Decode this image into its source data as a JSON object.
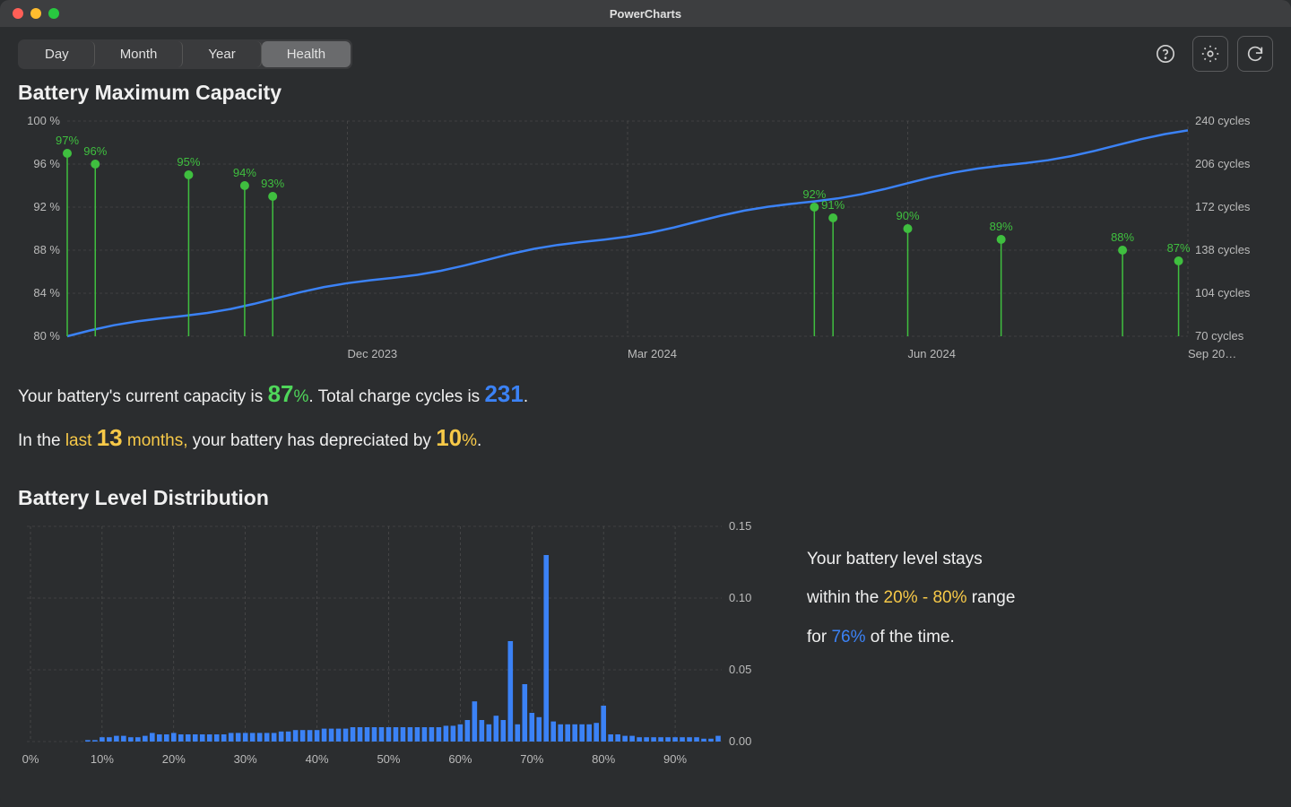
{
  "app_title": "PowerCharts",
  "tabs": {
    "day": "Day",
    "month": "Month",
    "year": "Year",
    "health": "Health",
    "active": "Health"
  },
  "sections": {
    "capacity_title": "Battery Maximum Capacity",
    "distribution_title": "Battery Level Distribution"
  },
  "summary1": {
    "pre_capacity": "Your battery's current capacity is ",
    "capacity_val": "87",
    "capacity_pct": "%",
    "mid": ". Total charge cycles is ",
    "cycles_val": "231",
    "end1": ".",
    "line2_a": "In the ",
    "line2_b": "last ",
    "months_val": "13",
    "months_unit": " months,",
    "line2_c": " your battery has depreciated by ",
    "dep_val": "10",
    "dep_pct": "%",
    "end2": "."
  },
  "summary2": {
    "l1": "Your battery level stays",
    "l2a": "within the ",
    "range_lo": "20",
    "range_sep": "% - ",
    "range_hi": "80",
    "range_pct": "%",
    "l2b": " range",
    "l3a": "for ",
    "pct_val": "76",
    "pct_unit": "%",
    "l3b": " of the time."
  },
  "chart_data": [
    {
      "type": "line+lollipop",
      "title": "Battery Maximum Capacity",
      "x_domain_months": [
        "Sep 2023",
        "Oct 2023",
        "Nov 2023",
        "Dec 2023",
        "Jan 2024",
        "Feb 2024",
        "Mar 2024",
        "Apr 2024",
        "May 2024",
        "Jun 2024",
        "Jul 2024",
        "Aug 2024",
        "Sep 2024"
      ],
      "y_left_label": "%",
      "y_left_ticks": [
        80,
        84,
        88,
        92,
        96,
        100
      ],
      "y_right_label": "cycles",
      "y_right_ticks": [
        70,
        104,
        138,
        172,
        206,
        240
      ],
      "x_ticks": [
        "Dec 2023",
        "Mar 2024",
        "Jun 2024",
        "Sep 20…"
      ],
      "capacity_points": [
        {
          "month_index": 0.0,
          "pct": 97
        },
        {
          "month_index": 0.3,
          "pct": 96
        },
        {
          "month_index": 1.3,
          "pct": 95
        },
        {
          "month_index": 1.9,
          "pct": 94
        },
        {
          "month_index": 2.2,
          "pct": 93
        },
        {
          "month_index": 8.0,
          "pct": 92
        },
        {
          "month_index": 8.2,
          "pct": 91
        },
        {
          "month_index": 9.0,
          "pct": 90
        },
        {
          "month_index": 10.0,
          "pct": 89
        },
        {
          "month_index": 11.3,
          "pct": 88
        },
        {
          "month_index": 11.9,
          "pct": 87
        }
      ],
      "cycles_line": {
        "start": {
          "month_index": 0.0,
          "cycles": 70
        },
        "end": {
          "month_index": 12.0,
          "cycles": 231
        }
      }
    },
    {
      "type": "bar",
      "title": "Battery Level Distribution",
      "x_label": "%",
      "x_ticks": [
        0,
        10,
        20,
        30,
        40,
        50,
        60,
        70,
        80,
        90
      ],
      "y_label": "",
      "y_ticks": [
        0.0,
        0.05,
        0.1,
        0.15
      ],
      "ylim": [
        0,
        0.15
      ],
      "categories": [
        0,
        1,
        2,
        3,
        4,
        5,
        6,
        7,
        8,
        9,
        10,
        11,
        12,
        13,
        14,
        15,
        16,
        17,
        18,
        19,
        20,
        21,
        22,
        23,
        24,
        25,
        26,
        27,
        28,
        29,
        30,
        31,
        32,
        33,
        34,
        35,
        36,
        37,
        38,
        39,
        40,
        41,
        42,
        43,
        44,
        45,
        46,
        47,
        48,
        49,
        50,
        51,
        52,
        53,
        54,
        55,
        56,
        57,
        58,
        59,
        60,
        61,
        62,
        63,
        64,
        65,
        66,
        67,
        68,
        69,
        70,
        71,
        72,
        73,
        74,
        75,
        76,
        77,
        78,
        79,
        80,
        81,
        82,
        83,
        84,
        85,
        86,
        87,
        88,
        89,
        90,
        91,
        92,
        93,
        94,
        95,
        96
      ],
      "values": [
        0.0,
        0.0,
        0.0,
        0.0,
        0.0,
        0.0,
        0.0,
        0.0,
        0.001,
        0.001,
        0.003,
        0.003,
        0.004,
        0.004,
        0.003,
        0.003,
        0.004,
        0.006,
        0.005,
        0.005,
        0.006,
        0.005,
        0.005,
        0.005,
        0.005,
        0.005,
        0.005,
        0.005,
        0.006,
        0.006,
        0.006,
        0.006,
        0.006,
        0.006,
        0.006,
        0.007,
        0.007,
        0.008,
        0.008,
        0.008,
        0.008,
        0.009,
        0.009,
        0.009,
        0.009,
        0.01,
        0.01,
        0.01,
        0.01,
        0.01,
        0.01,
        0.01,
        0.01,
        0.01,
        0.01,
        0.01,
        0.01,
        0.01,
        0.011,
        0.011,
        0.012,
        0.015,
        0.028,
        0.015,
        0.012,
        0.018,
        0.015,
        0.07,
        0.012,
        0.04,
        0.02,
        0.017,
        0.13,
        0.014,
        0.012,
        0.012,
        0.012,
        0.012,
        0.012,
        0.013,
        0.025,
        0.005,
        0.005,
        0.004,
        0.004,
        0.003,
        0.003,
        0.003,
        0.003,
        0.003,
        0.003,
        0.003,
        0.003,
        0.003,
        0.002,
        0.002,
        0.004
      ]
    }
  ]
}
